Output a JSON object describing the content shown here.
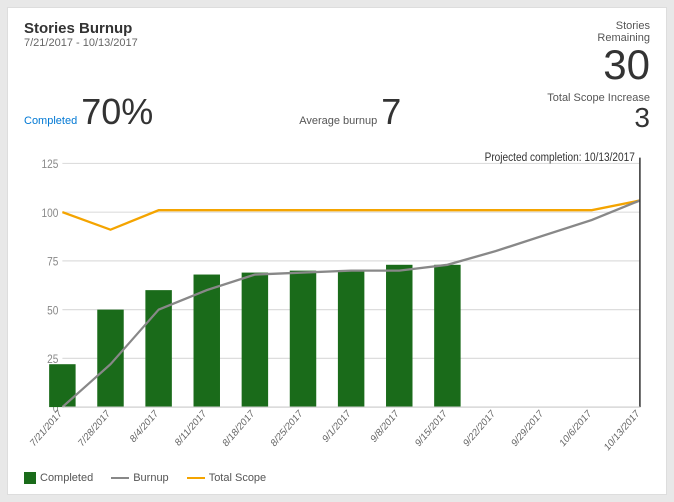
{
  "title": "Stories Burnup",
  "date_range": "7/21/2017 - 10/13/2017",
  "stories_remaining_label": "Stories Remaining",
  "stories_remaining_value": "30",
  "completed_label": "Completed",
  "completed_value": "70%",
  "avg_burnup_label": "Average burnup",
  "avg_burnup_value": "7",
  "total_scope_label": "Total Scope Increase",
  "total_scope_value": "3",
  "projection_label": "Projected completion: 10/13/2017",
  "legend": [
    {
      "label": "Completed",
      "type": "box"
    },
    {
      "label": "Burnup",
      "type": "line-gray"
    },
    {
      "label": "Total Scope",
      "type": "line-orange"
    }
  ],
  "chart": {
    "x_labels": [
      "7/21/2017",
      "7/28/2017",
      "8/4/2017",
      "8/11/2017",
      "8/18/2017",
      "8/25/2017",
      "9/1/2017",
      "9/8/2017",
      "9/15/2017",
      "9/22/2017",
      "9/29/2017",
      "10/6/2017",
      "10/13/2017"
    ],
    "y_max": 125,
    "bars": [
      22,
      50,
      60,
      68,
      69,
      70,
      70,
      73,
      73,
      0,
      0,
      0,
      0
    ],
    "burnup_line": [
      0,
      22,
      50,
      60,
      68,
      69,
      70,
      70,
      73,
      80,
      88,
      96,
      106
    ],
    "total_scope_line": [
      100,
      91,
      101,
      101,
      101,
      101,
      101,
      101,
      101,
      101,
      101,
      101,
      106
    ],
    "bar_color": "#1a6b1a",
    "burnup_color": "#888888",
    "scope_color": "#f4a400"
  }
}
